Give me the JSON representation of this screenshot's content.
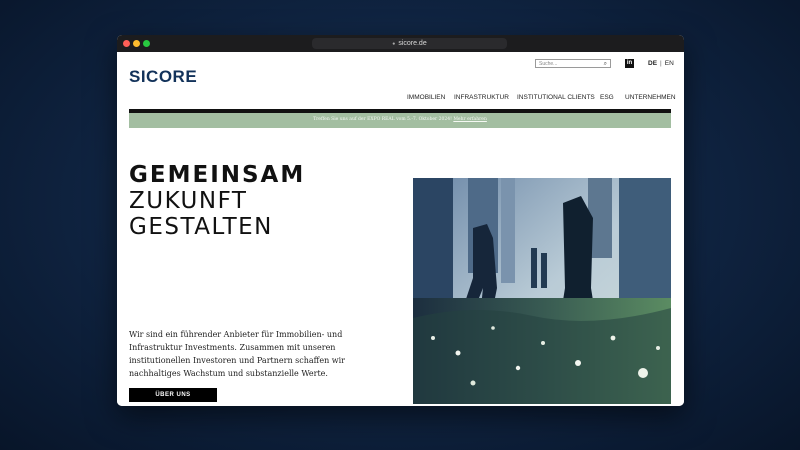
{
  "browser": {
    "url": "sicore.de"
  },
  "header": {
    "logo_text": "SICORE",
    "search_placeholder": "Suche...",
    "linkedin_label": "in",
    "lang_de": "DE",
    "lang_sep": "|",
    "lang_en": "EN"
  },
  "nav": {
    "items": [
      {
        "label": "IMMOBILIEN"
      },
      {
        "label": "INFRASTRUKTUR"
      },
      {
        "label": "INSTITUTIONAL CLIENTS"
      },
      {
        "label": "ESG"
      },
      {
        "label": "UNTERNEHMEN"
      }
    ]
  },
  "announcement": {
    "text": "Treffen Sie uns auf der EXPO REAL vom 5.-7. Oktober 2024!",
    "link": "Mehr erfahren"
  },
  "hero": {
    "line1": "GEMEINSAM",
    "line2": "ZUKUNFT",
    "line3": "GESTALTEN",
    "intro": "Wir sind ein führender Anbieter für Immobilien- und Infrastruktur Investments. Zusammen mit unseren institutionellen Investoren und Partnern schaffen wir nachhaltiges Wachstum und substanzielle Werte.",
    "cta": "ÜBER UNS"
  },
  "colors": {
    "brand": "#12325a",
    "band": "#a3bea1",
    "cta_bg": "#000000"
  },
  "icons": {
    "search": "search-icon",
    "linkedin": "linkedin-icon",
    "lock": "lock-icon"
  }
}
